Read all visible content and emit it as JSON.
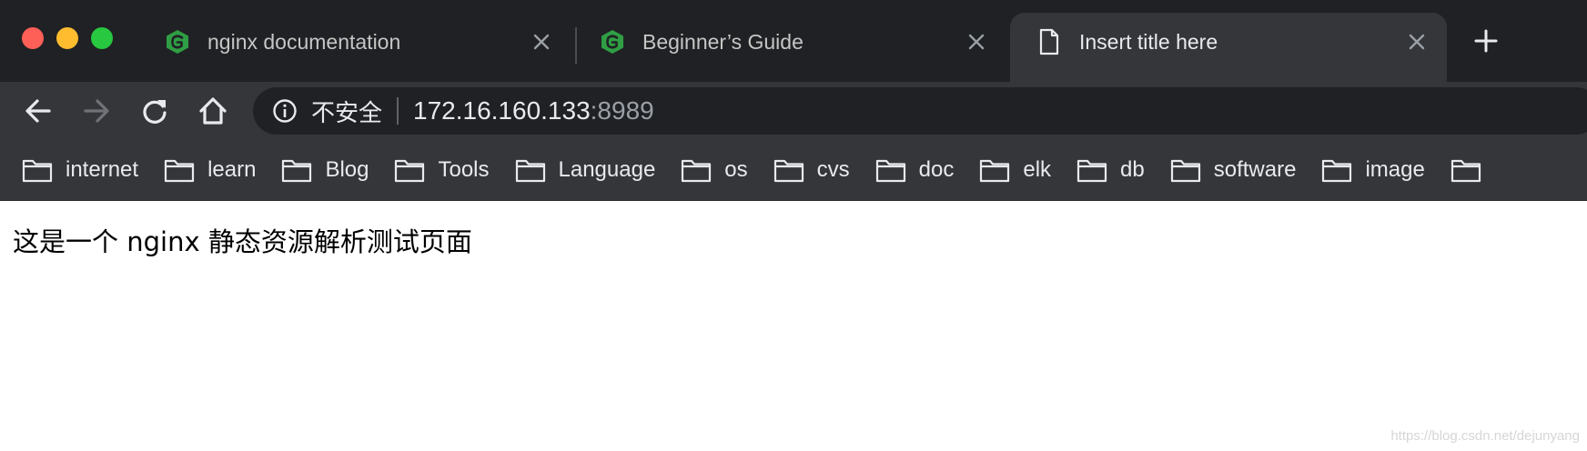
{
  "tabs": [
    {
      "title": "nginx documentation",
      "icon": "nginx-logo-icon"
    },
    {
      "title": "Beginner’s Guide",
      "icon": "nginx-logo-icon"
    },
    {
      "title": "Insert title here",
      "icon": "blank-page-icon",
      "active": true
    }
  ],
  "address": {
    "security_label": "不安全",
    "host": "172.16.160.133",
    "port": ":8989"
  },
  "bookmarks": [
    "internet",
    "learn",
    "Blog",
    "Tools",
    "Language",
    "os",
    "cvs",
    "doc",
    "elk",
    "db",
    "software",
    "image",
    ""
  ],
  "page": {
    "body_text": "这是一个 nginx 静态资源解析测试页面"
  },
  "watermark": "https://blog.csdn.net/dejunyang",
  "colors": {
    "chrome_dark": "#202124",
    "toolbar": "#35363a",
    "nginx_green": "#2f9e44"
  }
}
